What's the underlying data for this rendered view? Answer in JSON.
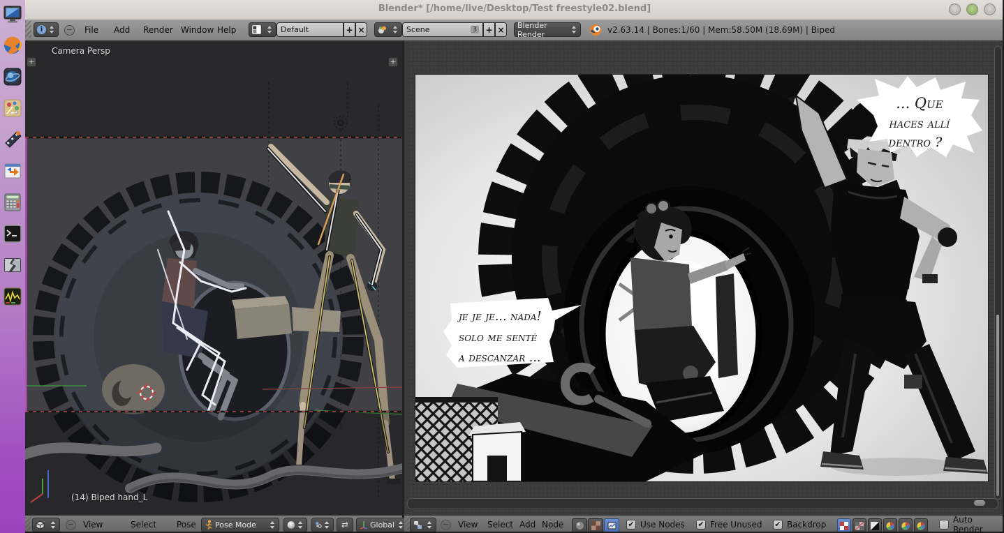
{
  "window": {
    "title": "Blender* [/home/live/Desktop/Test freestyle02.blend]",
    "controls": {
      "minimize": "minimize",
      "maximize": "maximize",
      "close": "close"
    }
  },
  "glyphs": {
    "plus": "+",
    "close": "×",
    "collapse": "−",
    "check": "✔",
    "snap_arrows": "⇄",
    "info": "i"
  },
  "dock": {
    "items": [
      "computer",
      "firefox",
      "network-tool",
      "graphics-editor",
      "video-editor",
      "media-converter",
      "calculator",
      "terminal",
      "file-splitter",
      "system-monitor"
    ]
  },
  "top_header": {
    "menus": [
      "File",
      "Add",
      "Render",
      "Window",
      "Help"
    ],
    "layout": {
      "value": "Default"
    },
    "scene": {
      "value": "Scene",
      "users": "3"
    },
    "engine": {
      "value": "Blender Render"
    },
    "status": "v2.63.14 | Bones:1/60 | Mem:58.50M (18.69M) | Biped"
  },
  "viewport": {
    "overlay": {
      "view_label": "Camera Persp",
      "active_bone": "(14) Biped hand_L"
    },
    "header": {
      "menus": [
        "View",
        "Select",
        "Pose"
      ],
      "mode": "Pose Mode",
      "orientation": "Global"
    }
  },
  "node_editor": {
    "header": {
      "menus": [
        "View",
        "Select",
        "Add",
        "Node"
      ],
      "use_nodes": "Use Nodes",
      "use_nodes_checked": true,
      "free_unused": "Free Unused",
      "free_unused_checked": true,
      "backdrop": "Backdrop",
      "backdrop_checked": true,
      "auto_render": "Auto Render",
      "auto_render_checked": false
    },
    "render_image": {
      "bubble_right": {
        "line1": "... Que",
        "line2": "haces allí",
        "line3": "dentro ?"
      },
      "bubble_left": {
        "line1": "je je je... nada!",
        "line2": "solo me senté",
        "line3": "a descanzar ..."
      }
    }
  },
  "colors": {
    "accent_blue": "#4a6fb5",
    "dock_top": "#cbb0d2",
    "dock_bottom": "#9a44bc",
    "header_grey": "#8f8f8f",
    "viewport_bg": "#3e3e42",
    "node_bg": "#3d3d3d",
    "camera_border_red": "#a04848",
    "bone_white": "#ecechf",
    "logo_orange": "#e8822c"
  }
}
